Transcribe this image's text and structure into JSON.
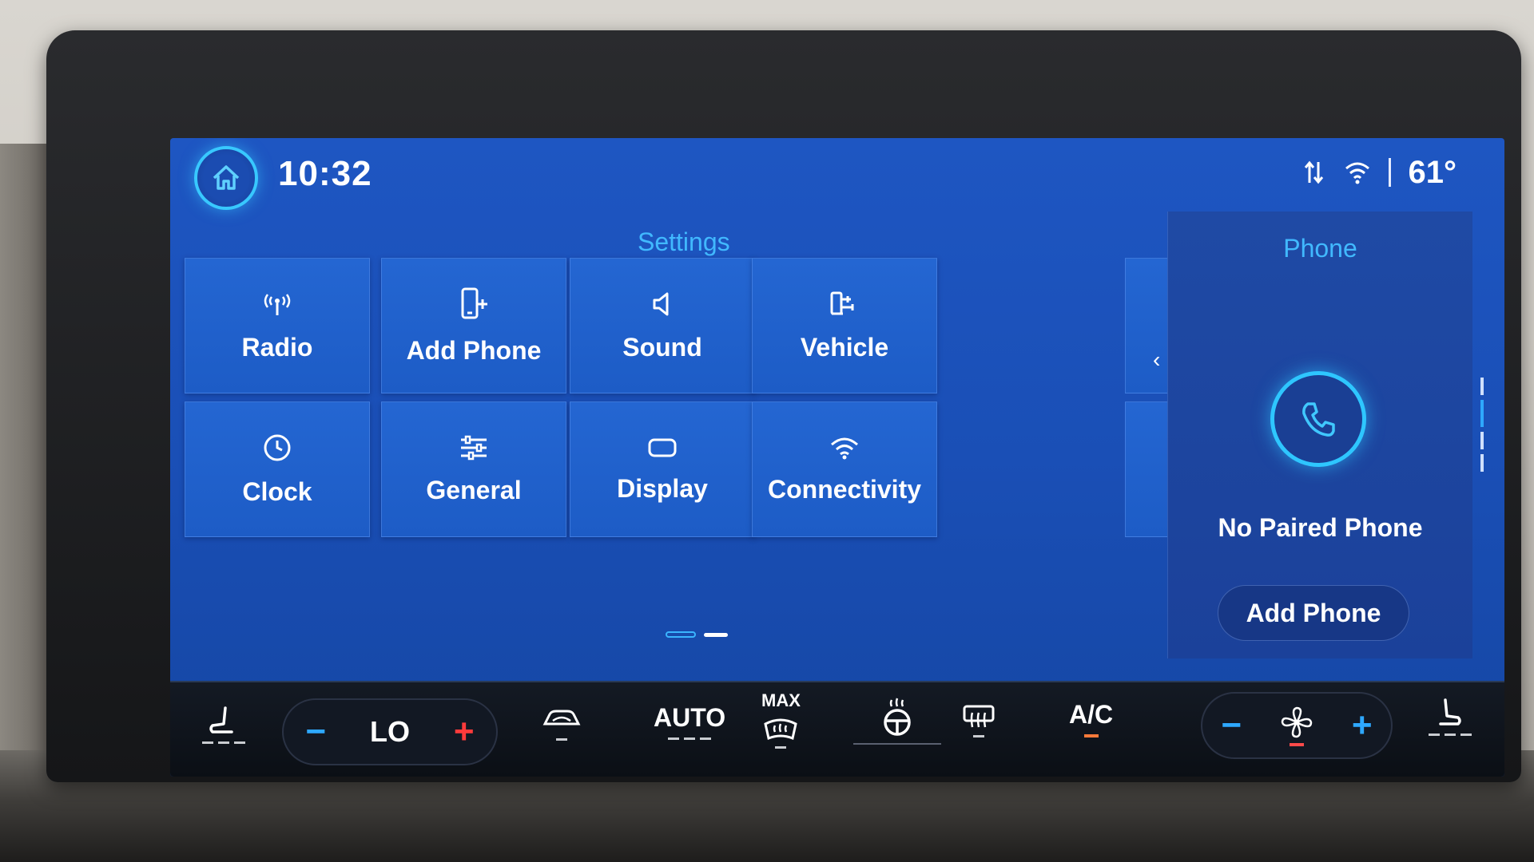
{
  "status_bar": {
    "time": "10:32",
    "temperature": "61°",
    "icons": [
      "home-icon",
      "data-transfer-icon",
      "wifi-signal-icon"
    ]
  },
  "settings": {
    "title": "Settings",
    "tiles": [
      {
        "label": "Radio",
        "icon": "radio-antenna-icon"
      },
      {
        "label": "Add Phone",
        "icon": "add-phone-icon"
      },
      {
        "label": "Sound",
        "icon": "speaker-icon"
      },
      {
        "label": "Vehicle",
        "icon": "vehicle-icon"
      },
      {
        "label": "Clock",
        "icon": "clock-icon"
      },
      {
        "label": "General",
        "icon": "sliders-icon"
      },
      {
        "label": "Display",
        "icon": "display-icon"
      },
      {
        "label": "Connectivity",
        "icon": "wifi-icon"
      }
    ],
    "page_indicator": {
      "pages": 2,
      "current": 2
    }
  },
  "phone_panel": {
    "title": "Phone",
    "status": "No Paired Phone",
    "button_label": "Add Phone",
    "icon": "phone-handset-icon"
  },
  "climate": {
    "driver_seat_icon": "seat-heat-icon",
    "temperature_label": "LO",
    "minus_label": "−",
    "plus_label": "+",
    "recirc_icon": "recirculation-icon",
    "auto_label": "AUTO",
    "max_label": "MAX",
    "max_defrost_icon": "max-defrost-icon",
    "heated_wheel_icon": "heated-steering-wheel-icon",
    "rear_defrost_icon": "rear-defrost-icon",
    "ac_label": "A/C",
    "fan_icon": "fan-icon",
    "fan_minus_label": "−",
    "fan_plus_label": "+",
    "passenger_seat_icon": "passenger-seat-icon"
  },
  "colors": {
    "accent": "#41b9ff",
    "screen_blue": "#1d56c0",
    "heat_red": "#ff3b3b",
    "cool_blue": "#2ea8ff",
    "active_orange": "#ff7a3a"
  }
}
